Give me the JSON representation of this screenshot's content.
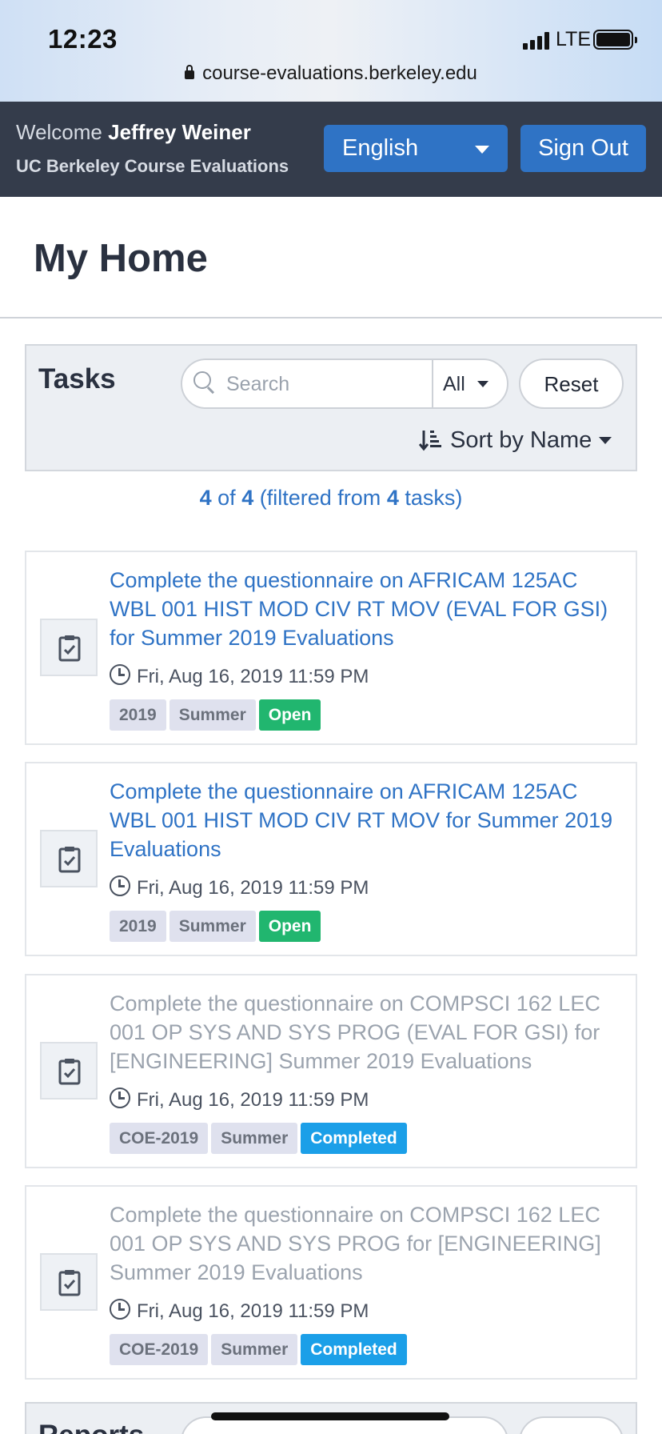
{
  "status_bar": {
    "time": "12:23",
    "network": "LTE",
    "url": "course-evaluations.berkeley.edu"
  },
  "header": {
    "welcome_prefix": "Welcome",
    "user_name": "Jeffrey Weiner",
    "subtitle": "UC Berkeley Course Evaluations",
    "language": "English",
    "sign_out": "Sign Out"
  },
  "page": {
    "title": "My Home"
  },
  "tasks_panel": {
    "title": "Tasks",
    "search_placeholder": "Search",
    "filter_value": "All",
    "reset_label": "Reset",
    "sort_label": "Sort by Name"
  },
  "count": {
    "shown": "4",
    "of_word": "of",
    "total": "4",
    "filtered_prefix": "(filtered from",
    "filtered_total": "4",
    "filtered_suffix": "tasks)"
  },
  "tasks": [
    {
      "title": "Complete the questionnaire on AFRICAM 125AC WBL 001 HIST MOD CIV RT MOV (EVAL FOR GSI) for Summer 2019 Evaluations",
      "due": "Fri, Aug 16, 2019 11:59 PM",
      "tags": [
        "2019",
        "Summer"
      ],
      "status": "Open"
    },
    {
      "title": "Complete the questionnaire on AFRICAM 125AC WBL 001 HIST MOD CIV RT MOV for Summer 2019 Evaluations",
      "due": "Fri, Aug 16, 2019 11:59 PM",
      "tags": [
        "2019",
        "Summer"
      ],
      "status": "Open"
    },
    {
      "title": "Complete the questionnaire on COMPSCI 162 LEC 001 OP SYS AND SYS PROG (EVAL FOR GSI) for [ENGINEERING] Summer 2019 Evaluations",
      "due": "Fri, Aug 16, 2019 11:59 PM",
      "tags": [
        "COE-2019",
        "Summer"
      ],
      "status": "Completed"
    },
    {
      "title": "Complete the questionnaire on COMPSCI 162 LEC 001 OP SYS AND SYS PROG for [ENGINEERING] Summer 2019 Evaluations",
      "due": "Fri, Aug 16, 2019 11:59 PM",
      "tags": [
        "COE-2019",
        "Summer"
      ],
      "status": "Completed"
    }
  ],
  "reports_panel": {
    "title": "Reports"
  },
  "colors": {
    "header_bg": "#343c4b",
    "primary": "#2f73c5",
    "open": "#21b66f",
    "completed": "#1b9fe8"
  }
}
